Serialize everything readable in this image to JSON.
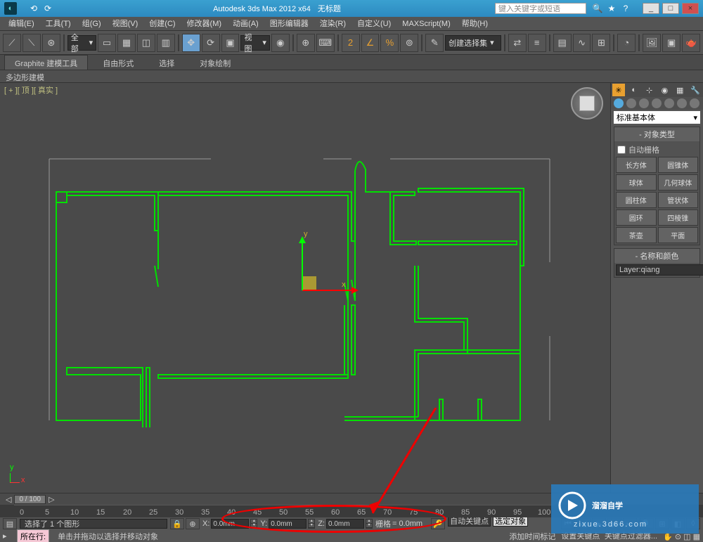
{
  "titlebar": {
    "app_title": "Autodesk 3ds Max 2012 x64",
    "doc_title": "无标题",
    "search_placeholder": "键入关键字或短语",
    "min": "_",
    "max": "□",
    "close": "×"
  },
  "menu": {
    "items": [
      "编辑(E)",
      "工具(T)",
      "组(G)",
      "视图(V)",
      "创建(C)",
      "修改器(M)",
      "动画(A)",
      "图形编辑器",
      "渲染(R)",
      "自定义(U)",
      "MAXScript(M)",
      "帮助(H)"
    ]
  },
  "toolbar": {
    "layer_dd": "全部",
    "view_dd": "视图",
    "selset_dd": "创建选择集"
  },
  "ribbon": {
    "tabs": [
      "Graphite 建模工具",
      "自由形式",
      "选择",
      "对象绘制"
    ],
    "sub": "多边形建模"
  },
  "viewport": {
    "label": "[ + ][ 顶 ][ 真实 ]",
    "axis_y": "y",
    "axis_x": "x"
  },
  "cmd": {
    "dropdown": "标准基本体",
    "rollout_objtype": "对象类型",
    "autogrid": "自动栅格",
    "buttons": [
      "长方体",
      "圆锥体",
      "球体",
      "几何球体",
      "圆柱体",
      "管状体",
      "圆环",
      "四棱锥",
      "茶壶",
      "平面"
    ],
    "rollout_name": "名称和颜色",
    "layer_name": "Layer:qiang"
  },
  "timeslider": {
    "label": "0 / 100"
  },
  "trackbar": {
    "ticks": [
      "0",
      "5",
      "10",
      "15",
      "20",
      "25",
      "30",
      "35",
      "40",
      "45",
      "50",
      "55",
      "60",
      "65",
      "70",
      "75",
      "80",
      "85",
      "90",
      "95",
      "100"
    ]
  },
  "status": {
    "sel": "选择了 1 个图形",
    "x_label": "X:",
    "x_val": "0.0mm",
    "y_label": "Y:",
    "y_val": "0.0mm",
    "z_label": "Z:",
    "z_val": "0.0mm",
    "grid_label": "栅格",
    "grid_val": "= 0.0mm",
    "autokey": "自动关键点",
    "setkey": "设置关键点",
    "selset": "选定对象",
    "keyfilt": "关键点过滤器..."
  },
  "status2": {
    "tag": "所在行:",
    "tip": "单击并拖动以选择并移动对象",
    "addtime": "添加时间标记"
  },
  "watermark": {
    "brand": "溜溜自学",
    "url": "zixue.3d66.com"
  }
}
